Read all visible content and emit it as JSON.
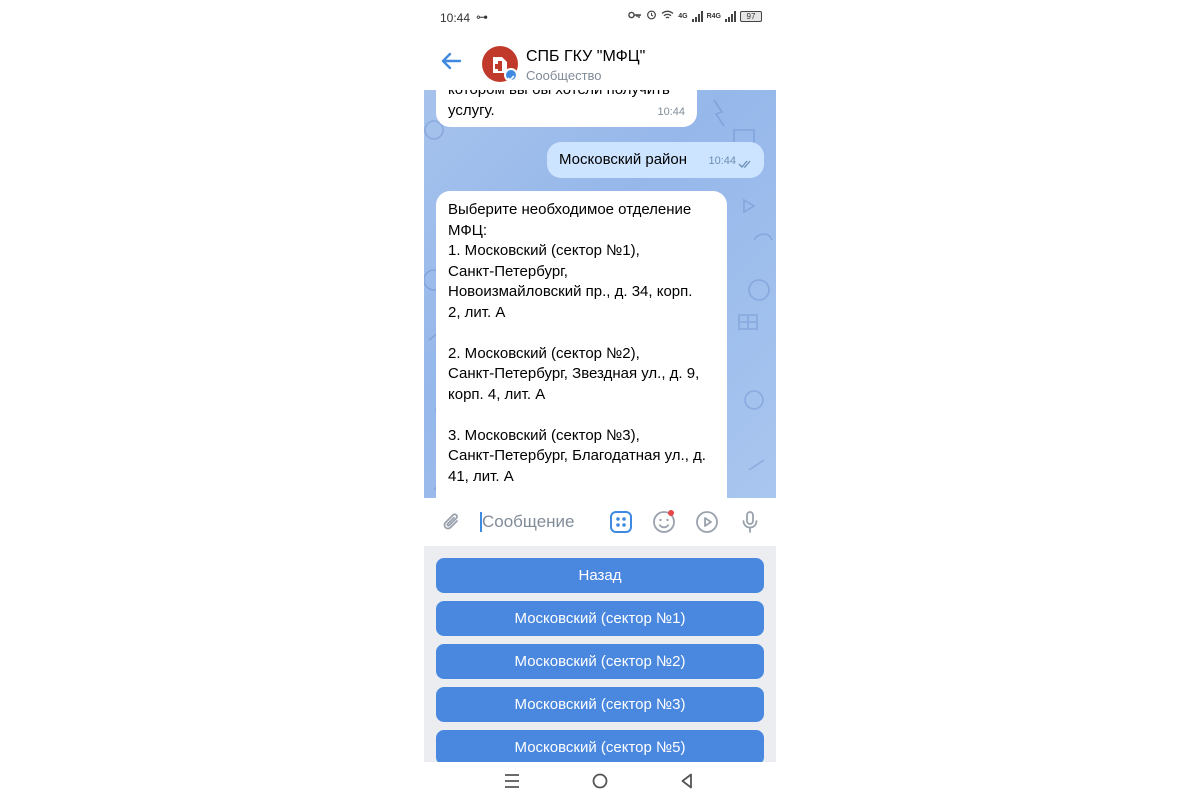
{
  "status_bar": {
    "time": "10:44",
    "key_glyph": "⊶",
    "net1": "4G",
    "net2": "R4G",
    "battery": "97"
  },
  "header": {
    "title": "СПБ ГКУ \"МФЦ\"",
    "subtitle": "Сообщество"
  },
  "messages": [
    {
      "direction": "in",
      "text": "котором вы бы хотели получить\nуслугу.",
      "time": "10:44"
    },
    {
      "direction": "out",
      "text": "Московский район",
      "time": "10:44"
    },
    {
      "direction": "in",
      "text": "Выберите необходимое отделение\nМФЦ:\n1. Московский (сектор №1),\nСанкт-Петербург,\nНовоизмайловский пр., д. 34, корп.\n2, лит. А\n\n2. Московский (сектор №2),\nСанкт-Петербург, Звездная ул., д. 9,\nкорп. 4, лит. А\n\n3. Московский (сектор №3),\nСанкт-Петербург, Благодатная ул., д.\n41, лит. А"
    }
  ],
  "input": {
    "placeholder": "Сообщение",
    "value": ""
  },
  "keyboard": {
    "buttons": [
      "Назад",
      "Московский (сектор №1)",
      "Московский (сектор №2)",
      "Московский (сектор №3)",
      "Московский (сектор №5)"
    ]
  },
  "icons": {
    "attach": "paperclip-icon",
    "apps": "apps-icon",
    "emoji": "emoji-icon",
    "play": "play-icon",
    "mic": "microphone-icon"
  },
  "colors": {
    "accent": "#3f8ae0",
    "button": "#4a88e0",
    "outgoing_bubble": "#cce4ff",
    "chat_background": "#a7c3ec",
    "avatar": "#c0392b"
  }
}
